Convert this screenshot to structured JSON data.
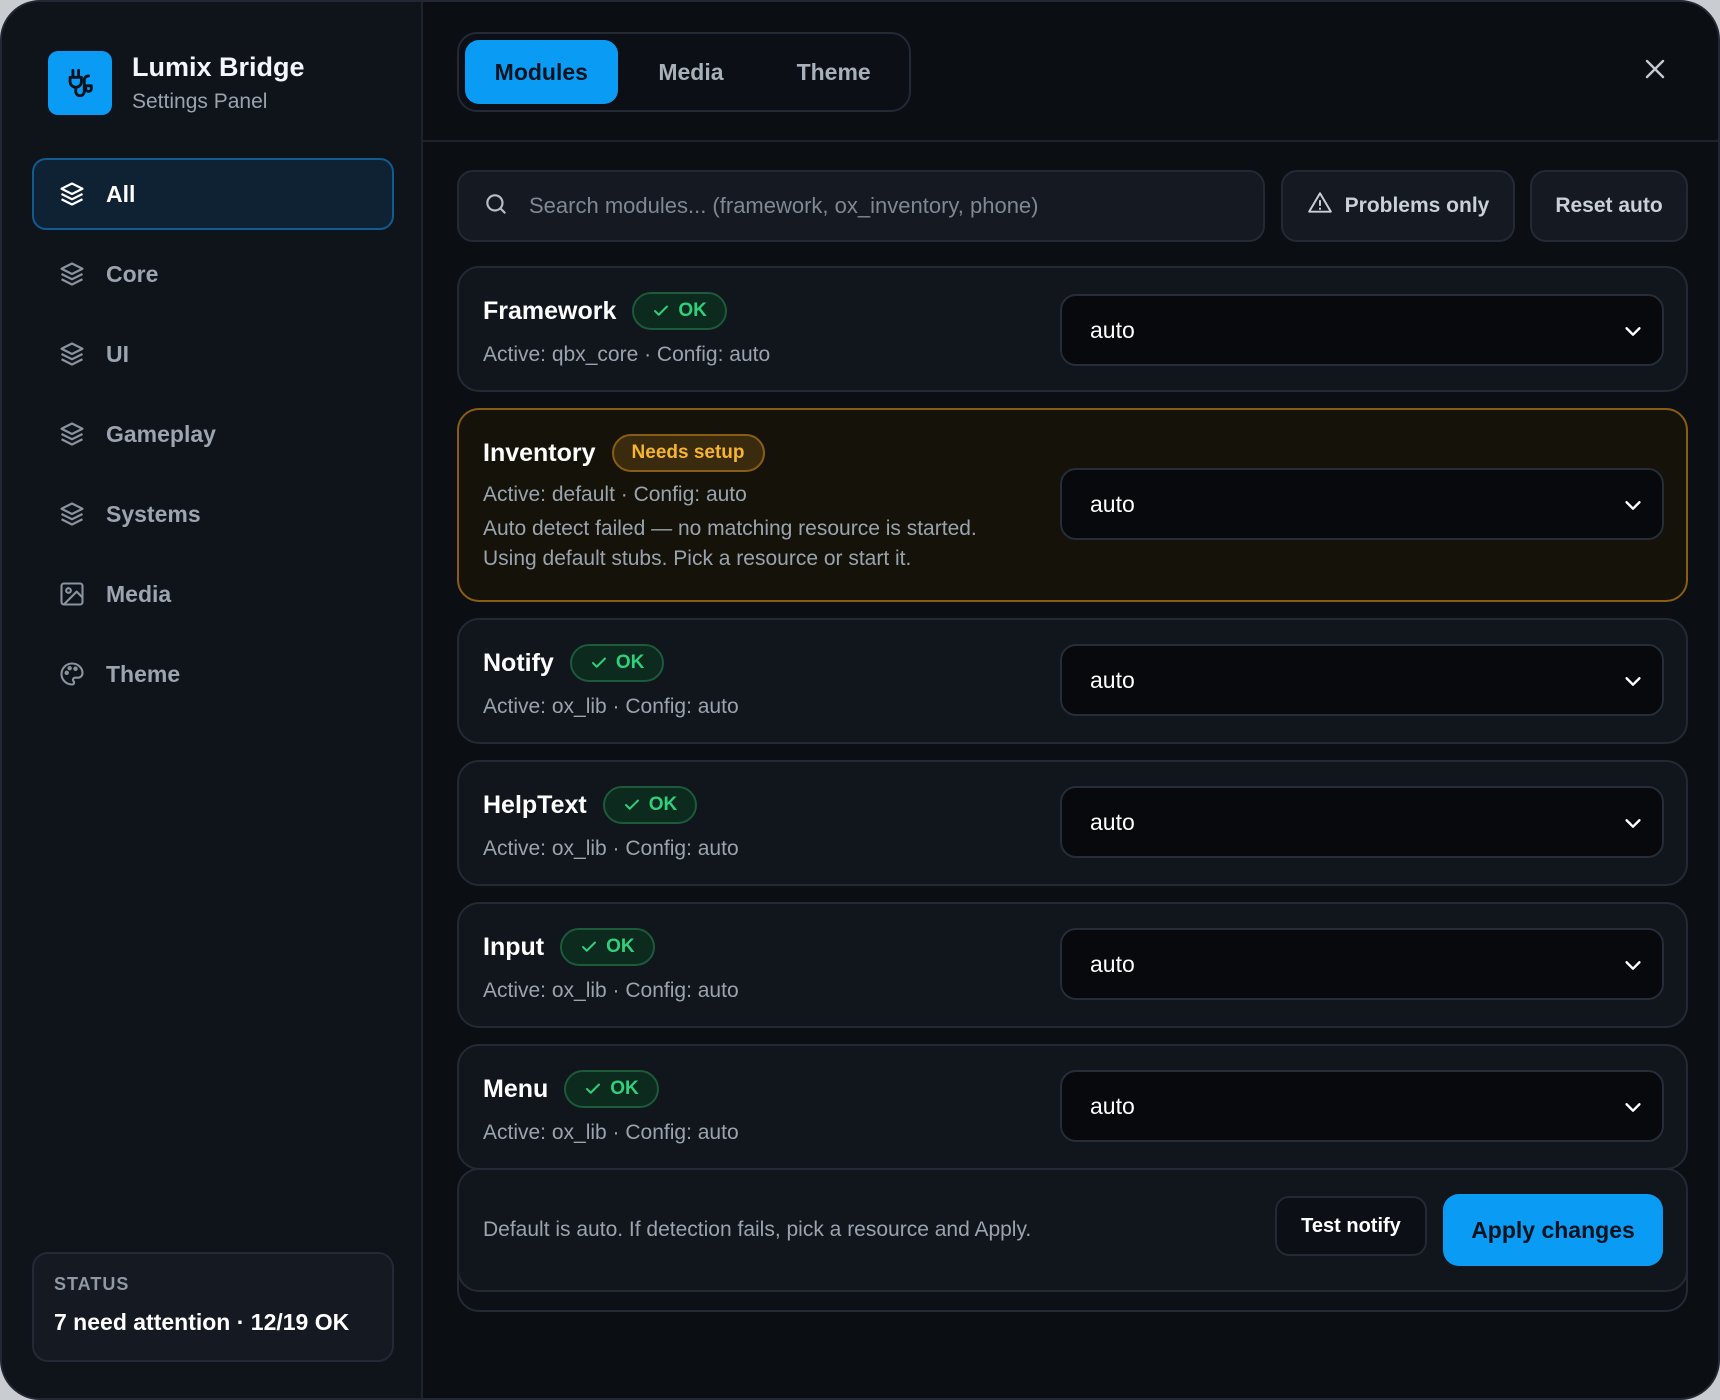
{
  "app": {
    "title": "Lumix Bridge",
    "subtitle": "Settings Panel",
    "logo_icon": "plug-icon",
    "accent_color": "#0a9cf5"
  },
  "sidebar": {
    "items": [
      {
        "label": "All",
        "icon": "layers-icon",
        "active": true
      },
      {
        "label": "Core",
        "icon": "layers-icon",
        "active": false
      },
      {
        "label": "UI",
        "icon": "layers-icon",
        "active": false
      },
      {
        "label": "Gameplay",
        "icon": "layers-icon",
        "active": false
      },
      {
        "label": "Systems",
        "icon": "layers-icon",
        "active": false
      },
      {
        "label": "Media",
        "icon": "image-icon",
        "active": false
      },
      {
        "label": "Theme",
        "icon": "palette-icon",
        "active": false
      }
    ],
    "status": {
      "title": "STATUS",
      "text": "7 need attention · 12/19 OK"
    }
  },
  "tabs": [
    {
      "label": "Modules",
      "active": true
    },
    {
      "label": "Media",
      "active": false
    },
    {
      "label": "Theme",
      "active": false
    }
  ],
  "toolbar": {
    "search_placeholder": "Search modules... (framework, ox_inventory, phone)",
    "search_value": "",
    "problems_label": "Problems only",
    "reset_label": "Reset auto"
  },
  "modules": [
    {
      "name": "Framework",
      "status": "OK",
      "status_type": "ok",
      "meta": "Active: qbx_core · Config: auto",
      "value": "auto"
    },
    {
      "name": "Inventory",
      "status": "Needs setup",
      "status_type": "warn",
      "meta": "Active: default · Config: auto",
      "note_line1": "Auto detect failed — no matching resource is started.",
      "note_line2": "Using default stubs. Pick a resource or start it.",
      "value": "auto"
    },
    {
      "name": "Notify",
      "status": "OK",
      "status_type": "ok",
      "meta": "Active: ox_lib · Config: auto",
      "value": "auto"
    },
    {
      "name": "HelpText",
      "status": "OK",
      "status_type": "ok",
      "meta": "Active: ox_lib · Config: auto",
      "value": "auto"
    },
    {
      "name": "Input",
      "status": "OK",
      "status_type": "ok",
      "meta": "Active: ox_lib · Config: auto",
      "value": "auto"
    },
    {
      "name": "Menu",
      "status": "OK",
      "status_type": "ok",
      "meta": "Active: ox_lib · Config: auto",
      "value": "auto"
    }
  ],
  "footer": {
    "text": "Default is auto. If detection fails, pick a resource and Apply.",
    "test_label": "Test notify",
    "apply_label": "Apply changes"
  },
  "colors": {
    "ok": "#2fd07b",
    "warn": "#f5b52e",
    "background": "#0b0e13"
  }
}
